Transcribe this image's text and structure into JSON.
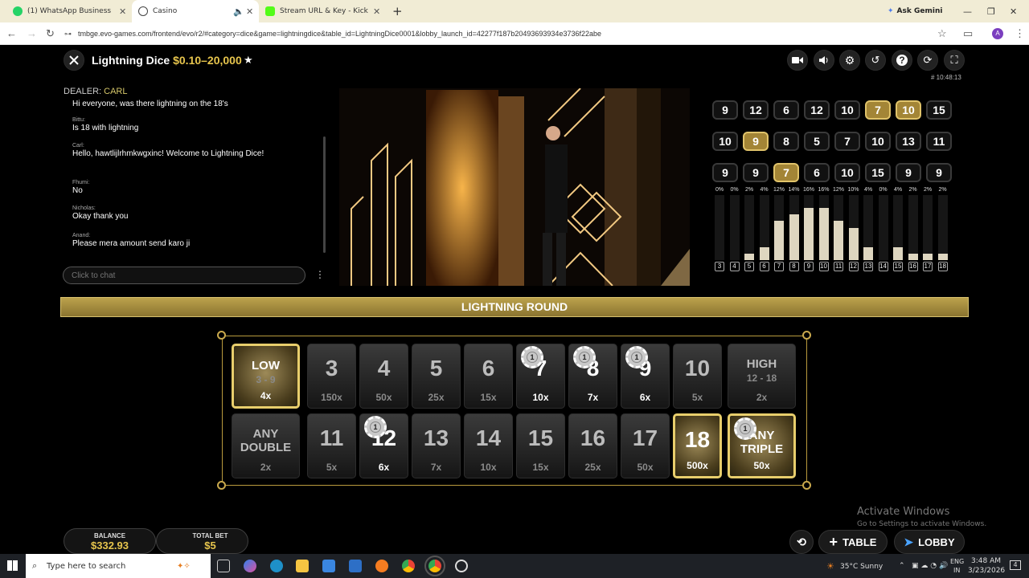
{
  "browser": {
    "tabs": [
      {
        "label": "(1) WhatsApp Business",
        "color": "#25d366"
      },
      {
        "label": "Casino",
        "color": "#444444"
      },
      {
        "label": "Stream URL & Key - Kick Dashb",
        "color": "#53fc18"
      }
    ],
    "new_tab": "+",
    "ask_gemini": "Ask Gemini",
    "url": "tmbge.evo-games.com/frontend/evo/r2/#category=dice&game=lightningdice&table_id=LightningDice0001&lobby_launch_id=42277f187b20493693934e3736f22abe",
    "profile_initial": "A"
  },
  "game": {
    "title": "Lightning Dice",
    "limits": "$0.10–20,000",
    "round_id": "# 10:48:13",
    "dealer_label": "DEALER:",
    "dealer_name": "CARL"
  },
  "chat": {
    "messages": [
      {
        "who": "",
        "text": "Hi everyone, was there lightning on the 18's"
      },
      {
        "who": "Bittu:",
        "text": "Is 18 with lightning"
      },
      {
        "who": "Carl:",
        "text": "Hello, hawtlijlrhmkwgxinc! Welcome to Lightning Dice!"
      },
      {
        "who": "Fhumi:",
        "text": "No"
      },
      {
        "who": "Nicholas:",
        "text": "Okay thank you"
      },
      {
        "who": "Anand:",
        "text": "Please mera amount send karo ji"
      }
    ],
    "placeholder": "Click to chat",
    "more": "⋮"
  },
  "history": {
    "rows": [
      [
        {
          "v": "9",
          "g": false
        },
        {
          "v": "12",
          "g": false
        },
        {
          "v": "6",
          "g": false
        },
        {
          "v": "12",
          "g": false
        },
        {
          "v": "10",
          "g": false
        },
        {
          "v": "7",
          "g": true
        },
        {
          "v": "10",
          "g": true
        },
        {
          "v": "15",
          "g": false
        }
      ],
      [
        {
          "v": "10",
          "g": false
        },
        {
          "v": "9",
          "g": true
        },
        {
          "v": "8",
          "g": false
        },
        {
          "v": "5",
          "g": false
        },
        {
          "v": "7",
          "g": false
        },
        {
          "v": "10",
          "g": false
        },
        {
          "v": "13",
          "g": false
        },
        {
          "v": "11",
          "g": false
        }
      ],
      [
        {
          "v": "9",
          "g": false
        },
        {
          "v": "9",
          "g": false
        },
        {
          "v": "7",
          "g": true
        },
        {
          "v": "6",
          "g": false
        },
        {
          "v": "10",
          "g": false
        },
        {
          "v": "15",
          "g": false
        },
        {
          "v": "9",
          "g": false
        },
        {
          "v": "9",
          "g": false
        }
      ]
    ]
  },
  "stats": {
    "labels": [
      "3",
      "4",
      "5",
      "6",
      "7",
      "8",
      "9",
      "10",
      "11",
      "12",
      "13",
      "14",
      "15",
      "16",
      "17",
      "18"
    ],
    "percents": [
      "0%",
      "0%",
      "2%",
      "4%",
      "12%",
      "14%",
      "16%",
      "16%",
      "12%",
      "10%",
      "4%",
      "0%",
      "4%",
      "2%",
      "2%",
      "2%"
    ],
    "values": [
      0,
      0,
      2,
      4,
      12,
      14,
      16,
      16,
      12,
      10,
      4,
      0,
      4,
      2,
      2,
      2
    ]
  },
  "lightning_round": "LIGHTNING ROUND",
  "bet_top": [
    {
      "type": "word",
      "word": "LOW",
      "sub": "3 - 9",
      "odds": "4x",
      "light": true,
      "chip": false
    },
    {
      "type": "num",
      "num": "3",
      "odds": "150x",
      "light": false,
      "chip": false
    },
    {
      "type": "num",
      "num": "4",
      "odds": "50x",
      "light": false,
      "chip": false
    },
    {
      "type": "num",
      "num": "5",
      "odds": "25x",
      "light": false,
      "chip": false
    },
    {
      "type": "num",
      "num": "6",
      "odds": "15x",
      "light": false,
      "chip": false
    },
    {
      "type": "num",
      "num": "7",
      "odds": "10x",
      "light": false,
      "chip": true
    },
    {
      "type": "num",
      "num": "8",
      "odds": "7x",
      "light": false,
      "chip": true
    },
    {
      "type": "num",
      "num": "9",
      "odds": "6x",
      "light": false,
      "chip": true
    },
    {
      "type": "num",
      "num": "10",
      "odds": "5x",
      "light": false,
      "chip": false
    },
    {
      "type": "word",
      "word": "HIGH",
      "sub": "12 - 18",
      "odds": "2x",
      "light": false,
      "chip": false
    }
  ],
  "bet_bottom": [
    {
      "type": "word",
      "word": "ANY DOUBLE",
      "sub": "",
      "odds": "2x",
      "light": false,
      "chip": false
    },
    {
      "type": "num",
      "num": "11",
      "odds": "5x",
      "light": false,
      "chip": false
    },
    {
      "type": "num",
      "num": "12",
      "odds": "6x",
      "light": false,
      "chip": true
    },
    {
      "type": "num",
      "num": "13",
      "odds": "7x",
      "light": false,
      "chip": false
    },
    {
      "type": "num",
      "num": "14",
      "odds": "10x",
      "light": false,
      "chip": false
    },
    {
      "type": "num",
      "num": "15",
      "odds": "15x",
      "light": false,
      "chip": false
    },
    {
      "type": "num",
      "num": "16",
      "odds": "25x",
      "light": false,
      "chip": false
    },
    {
      "type": "num",
      "num": "17",
      "odds": "50x",
      "light": false,
      "chip": false
    },
    {
      "type": "num",
      "num": "18",
      "odds": "500x",
      "light": true,
      "chip": false
    },
    {
      "type": "word",
      "word": "ANY TRIPLE",
      "sub": "",
      "odds": "50x",
      "light": true,
      "chip": true
    }
  ],
  "chip_value": "1",
  "footer": {
    "balance_label": "BALANCE",
    "balance": "$332.93",
    "totalbet_label": "TOTAL BET",
    "totalbet": "$5",
    "table_button": "TABLE",
    "lobby_button": "LOBBY"
  },
  "watermark": {
    "title": "Activate Windows",
    "subtitle": "Go to Settings to activate Windows."
  },
  "taskbar": {
    "search_placeholder": "Type here to search",
    "weather": "35°C  Sunny",
    "lang": "ENG",
    "region": "IN",
    "time": "3:48 AM",
    "date": "3/23/2026",
    "notif_count": "4"
  },
  "colors": {
    "gold": "#e7c54d",
    "accent": "#d8c16e"
  }
}
